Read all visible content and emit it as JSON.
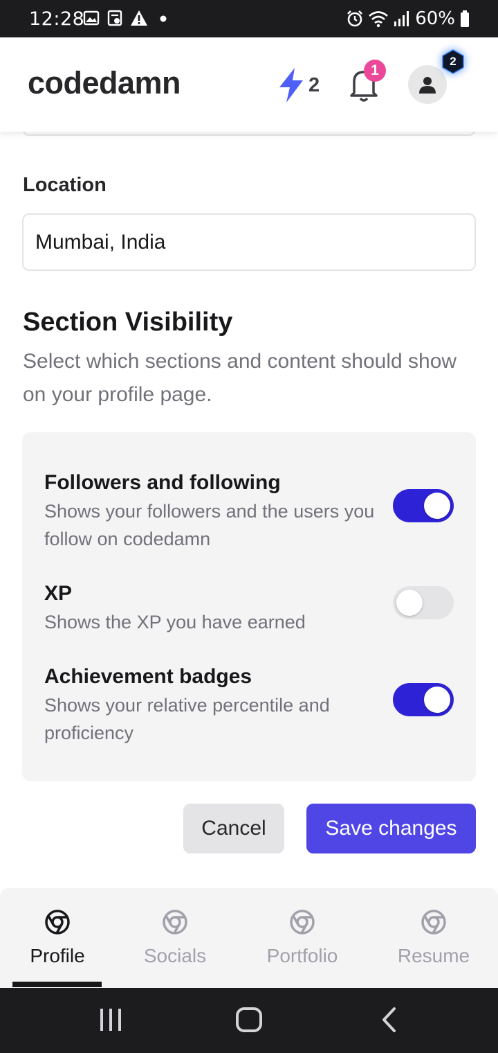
{
  "status_bar": {
    "time": "12:28",
    "battery": "60%",
    "icons_left": [
      "gallery-icon",
      "clipboard-icon",
      "warning-icon",
      "dot-icon"
    ],
    "icons_right": [
      "alarm-icon",
      "wifi-icon",
      "signal-icon",
      "battery-icon"
    ]
  },
  "header": {
    "logo": "codedamn",
    "xp_streak": "2",
    "notifications_count": "1",
    "level": "2",
    "colors": {
      "bolt": "#4f46e5",
      "badge": "#ec4899",
      "level_hex": "#0f172a"
    }
  },
  "form": {
    "location_label": "Location",
    "location_value": "Mumbai, India"
  },
  "visibility": {
    "title": "Section Visibility",
    "description": "Select which sections and content should show on your profile page.",
    "options": [
      {
        "title": "Followers and following",
        "description": "Shows your followers and the users you follow on codedamn",
        "enabled": true
      },
      {
        "title": "XP",
        "description": "Shows the XP you have earned",
        "enabled": false
      },
      {
        "title": "Achievement badges",
        "description": "Shows your relative percentile and proficiency",
        "enabled": true
      }
    ]
  },
  "actions": {
    "cancel": "Cancel",
    "save": "Save changes"
  },
  "tabs": [
    {
      "label": "Profile",
      "active": true
    },
    {
      "label": "Socials",
      "active": false
    },
    {
      "label": "Portfolio",
      "active": false
    },
    {
      "label": "Resume",
      "active": false
    }
  ],
  "colors": {
    "toggle_on": "#2e22d6",
    "toggle_off": "#e4e4e7",
    "primary": "#4f46e5"
  }
}
